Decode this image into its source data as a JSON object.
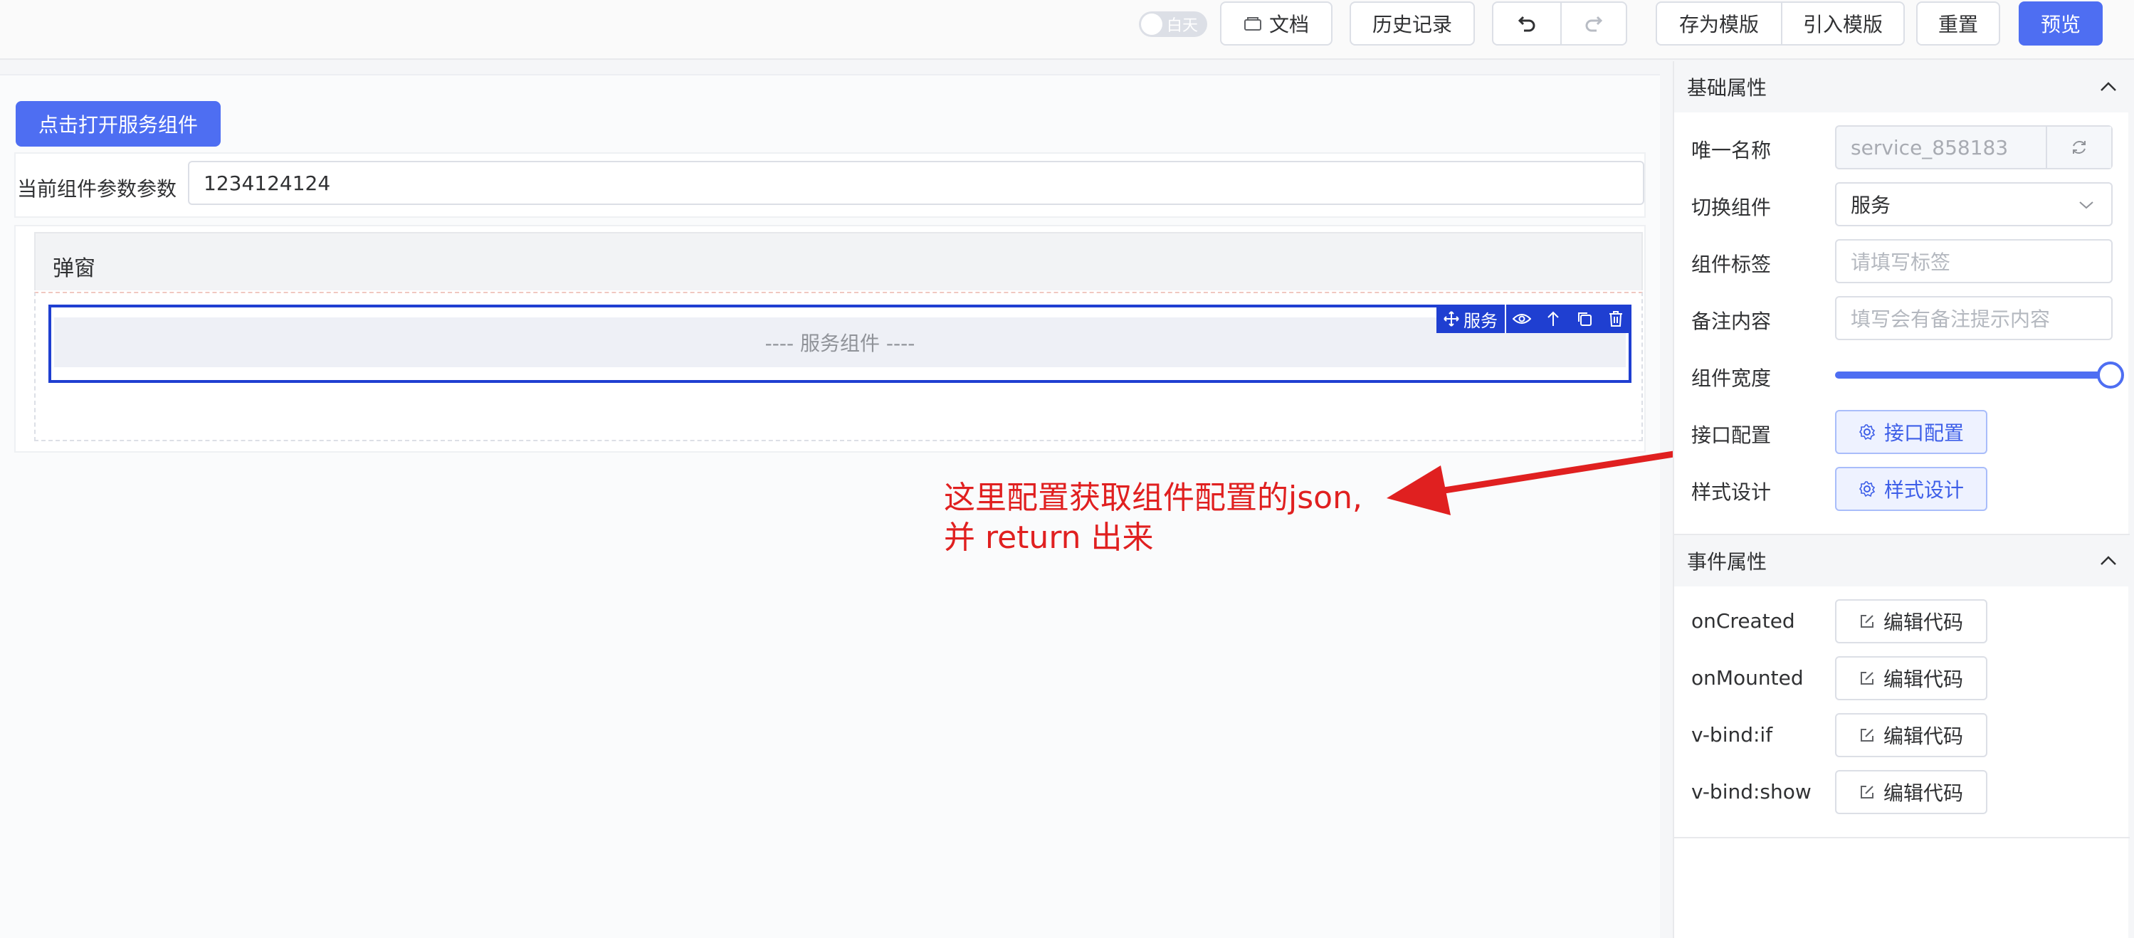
{
  "toolbar": {
    "theme_toggle_label": "白天",
    "docs_label": "文档",
    "history_label": "历史记录",
    "save_template_label": "存为模版",
    "import_template_label": "引入模版",
    "reset_label": "重置",
    "preview_label": "预览"
  },
  "canvas": {
    "open_service_button": "点击打开服务组件",
    "param_label": "当前组件参数参数",
    "param_value": "1234124124",
    "dialog_title": "弹窗",
    "service_placeholder": "---- 服务组件 ----",
    "service_tag": "服务"
  },
  "annotation": {
    "line1": "这里配置获取组件配置的json,",
    "line2": "并 return 出来",
    "color": "#e02020"
  },
  "panel": {
    "basic_section": "基础属性",
    "unique_name_label": "唯一名称",
    "unique_name_value": "service_858183",
    "switch_component_label": "切换组件",
    "switch_component_value": "服务",
    "component_tag_label": "组件标签",
    "component_tag_placeholder": "请填写标签",
    "remark_label": "备注内容",
    "remark_placeholder": "填写会有备注提示内容",
    "width_label": "组件宽度",
    "width_value_percent": 100,
    "api_config_label": "接口配置",
    "api_config_button": "接口配置",
    "style_design_label": "样式设计",
    "style_design_button": "样式设计",
    "event_section": "事件属性",
    "events": [
      {
        "label": "onCreated",
        "button": "编辑代码"
      },
      {
        "label": "onMounted",
        "button": "编辑代码"
      },
      {
        "label": "v-bind:if",
        "button": "编辑代码"
      },
      {
        "label": "v-bind:show",
        "button": "编辑代码"
      }
    ]
  },
  "colors": {
    "primary": "#4e6ef2",
    "selection": "#1f3fd1"
  }
}
